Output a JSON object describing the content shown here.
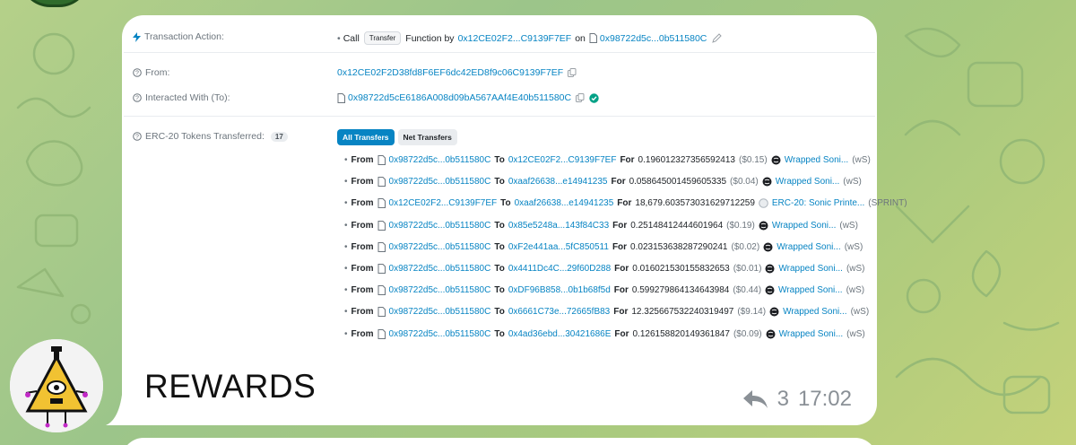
{
  "tx": {
    "action_label": "Transaction Action:",
    "action_call": "Call",
    "action_function": "Transfer",
    "action_function_by": "Function by",
    "action_from_short": "0x12CE02F2...C9139F7EF",
    "action_on": "on",
    "action_to_short": "0x98722d5c...0b511580C",
    "from_label": "From:",
    "from_value": "0x12CE02F2D38fd8F6EF6dc42ED8f9c06C9139F7EF",
    "to_label": "Interacted With (To):",
    "to_value": "0x98722d5cE6186A008d09bA567AAf4E40b511580C",
    "erc20_label": "ERC-20 Tokens Transferred:",
    "erc20_count": "17",
    "tab_all": "All Transfers",
    "tab_net": "Net Transfers",
    "word_from": "From",
    "word_to": "To",
    "word_for": "For",
    "transfers": [
      {
        "from": "0x98722d5c...0b511580C",
        "to": "0x12CE02F2...C9139F7EF",
        "amount": "0.196012327356592413",
        "usd": "($0.15)",
        "token": "Wrapped Soni...",
        "symbol": "(wS)"
      },
      {
        "from": "0x98722d5c...0b511580C",
        "to": "0xaaf26638...e14941235",
        "amount": "0.058645001459605335",
        "usd": "($0.04)",
        "token": "Wrapped Soni...",
        "symbol": "(wS)"
      },
      {
        "from": "0x12CE02F2...C9139F7EF",
        "to": "0xaaf26638...e14941235",
        "amount": "18,679.603573031629712259",
        "usd": "",
        "token": "ERC-20: Sonic Printe...",
        "symbol": "(SPRINT)"
      },
      {
        "from": "0x98722d5c...0b511580C",
        "to": "0x85e5248a...143f84C33",
        "amount": "0.25148412444601964",
        "usd": "($0.19)",
        "token": "Wrapped Soni...",
        "symbol": "(wS)"
      },
      {
        "from": "0x98722d5c...0b511580C",
        "to": "0xF2e441aa...5fC850511",
        "amount": "0.023153638287290241",
        "usd": "($0.02)",
        "token": "Wrapped Soni...",
        "symbol": "(wS)"
      },
      {
        "from": "0x98722d5c...0b511580C",
        "to": "0x4411Dc4C...29f60D288",
        "amount": "0.016021530155832653",
        "usd": "($0.01)",
        "token": "Wrapped Soni...",
        "symbol": "(wS)"
      },
      {
        "from": "0x98722d5c...0b511580C",
        "to": "0xDF96B858...0b1b68f5d",
        "amount": "0.599279864134643984",
        "usd": "($0.44)",
        "token": "Wrapped Soni...",
        "symbol": "(wS)"
      },
      {
        "from": "0x98722d5c...0b511580C",
        "to": "0x6661C73e...72665fB83",
        "amount": "12.325667532240319497",
        "usd": "($9.14)",
        "token": "Wrapped Soni...",
        "symbol": "(wS)"
      },
      {
        "from": "0x98722d5c...0b511580C",
        "to": "0x4ad36ebd...30421686E",
        "amount": "0.126158820149361847",
        "usd": "($0.09)",
        "token": "Wrapped Soni...",
        "symbol": "(wS)"
      }
    ]
  },
  "message": {
    "text": "REWARDS",
    "reply_count": "3",
    "time": "17:02"
  },
  "colors": {
    "link": "#0784c3",
    "success": "#00a186",
    "bubble": "#ffffff"
  }
}
